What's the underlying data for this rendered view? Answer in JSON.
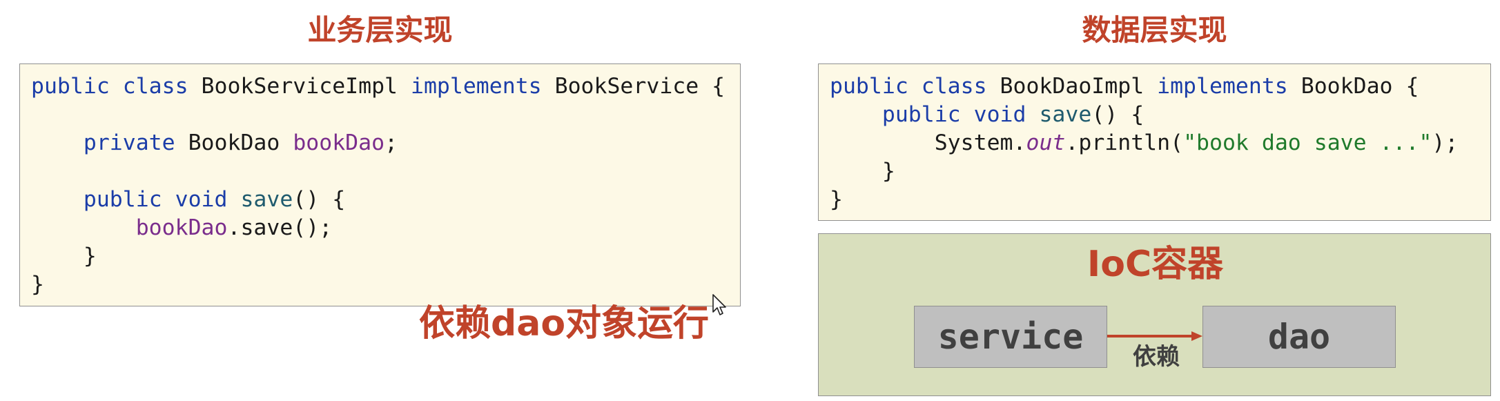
{
  "business_layer": {
    "heading": "业务层实现",
    "code_lines": [
      [
        {
          "t": "public class",
          "c": "kw"
        },
        {
          "t": " BookServiceImpl "
        },
        {
          "t": "implements",
          "c": "kw"
        },
        {
          "t": " BookService {"
        }
      ],
      [],
      [
        {
          "t": "    "
        },
        {
          "t": "private",
          "c": "kw"
        },
        {
          "t": " BookDao "
        },
        {
          "t": "bookDao",
          "c": "field"
        },
        {
          "t": ";"
        }
      ],
      [],
      [
        {
          "t": "    "
        },
        {
          "t": "public void",
          "c": "kw"
        },
        {
          "t": " "
        },
        {
          "t": "save",
          "c": "mth"
        },
        {
          "t": "() {"
        }
      ],
      [
        {
          "t": "        "
        },
        {
          "t": "bookDao",
          "c": "field"
        },
        {
          "t": ".save();"
        }
      ],
      [
        {
          "t": "    }"
        }
      ],
      [
        {
          "t": "}"
        }
      ]
    ],
    "annotation": "依赖dao对象运行"
  },
  "data_layer": {
    "heading": "数据层实现",
    "code_lines": [
      [
        {
          "t": "public class",
          "c": "kw"
        },
        {
          "t": " BookDaoImpl "
        },
        {
          "t": "implements",
          "c": "kw"
        },
        {
          "t": " BookDao {"
        }
      ],
      [
        {
          "t": "    "
        },
        {
          "t": "public void",
          "c": "kw"
        },
        {
          "t": " "
        },
        {
          "t": "save",
          "c": "mth"
        },
        {
          "t": "() {"
        }
      ],
      [
        {
          "t": "        System."
        },
        {
          "t": "out",
          "c": "static"
        },
        {
          "t": ".println("
        },
        {
          "t": "\"book dao save ...\"",
          "c": "str"
        },
        {
          "t": ");"
        }
      ],
      [
        {
          "t": "    }"
        }
      ],
      [
        {
          "t": "}"
        }
      ]
    ]
  },
  "ioc_container": {
    "title": "IoC容器",
    "source_bean": "service",
    "target_bean": "dao",
    "relation_label": "依赖"
  },
  "colors": {
    "accent": "#c0432a",
    "code_background": "#fdf9e6",
    "container_background": "#d9dfbd",
    "bean_fill": "#bfbfbf",
    "keyword": "#1b3da8",
    "field": "#7a2d8c",
    "string": "#1f7a2b"
  },
  "icons": [
    "mouse-cursor-icon",
    "dependency-arrow"
  ]
}
